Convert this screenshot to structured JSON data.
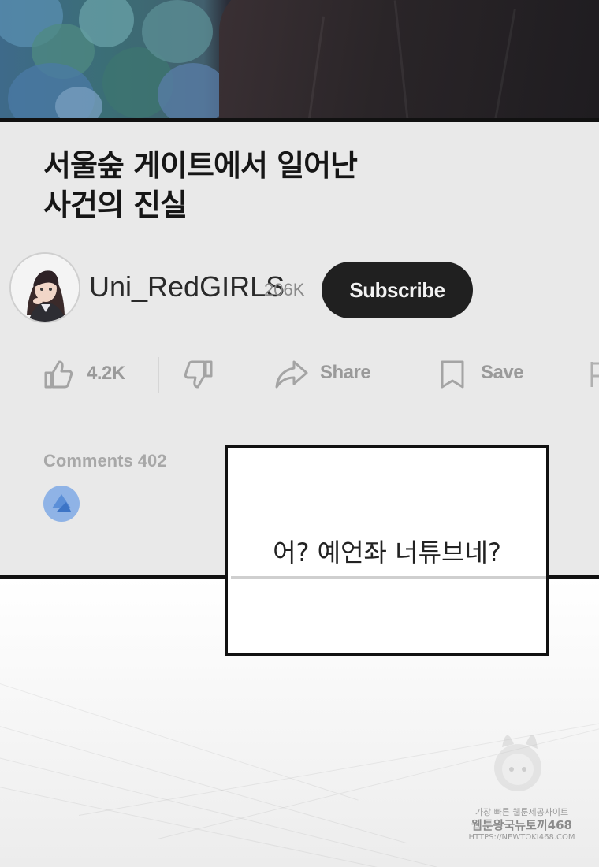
{
  "video": {
    "title_line1": "서울숲 게이트에서 일어난",
    "title_line2": "사건의 진실"
  },
  "channel": {
    "name": "Uni_RedGIRLS",
    "subscribers": "206K",
    "subscribe_label": "Subscribe"
  },
  "actions": {
    "likes": "4.2K",
    "share_label": "Share",
    "save_label": "Save"
  },
  "comments": {
    "label": "Comments 402"
  },
  "speech": {
    "text": "어? 예언좌 너튜브네?"
  },
  "watermark": {
    "line1": "가장 빠른 웹툰제공사이트",
    "line2": "웹툰왕국뉴토끼468",
    "line3": "HTTPS://NEWTOKI468.COM"
  },
  "icons": [
    "like-icon",
    "dislike-icon",
    "share-icon",
    "save-icon",
    "flag-icon",
    "user-avatar-icon"
  ],
  "colors": {
    "panel_bg": "#e9e9e9",
    "subscribe_bg": "#202020",
    "subscribe_text": "#f2f2f2"
  }
}
